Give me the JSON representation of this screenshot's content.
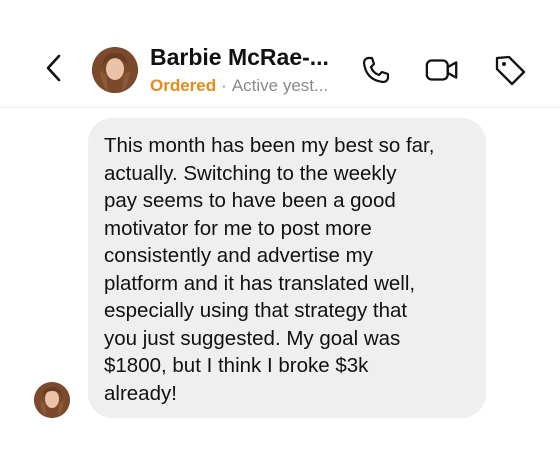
{
  "header": {
    "contact_name": "Barbie McRae-...",
    "status": "Ordered",
    "separator": "·",
    "activity": "Active yest..."
  },
  "icons": {
    "back": "chevron-left-icon",
    "call": "phone-icon",
    "video": "video-camera-icon",
    "tag": "tag-icon"
  },
  "colors": {
    "status_accent": "#e88a1a",
    "bubble_background": "#efefef"
  },
  "messages": [
    {
      "sender": "incoming",
      "text": "This month has been my best so far,\nactually. Switching to the weekly\npay seems to have been a good\nmotivator for me to post more\nconsistently and advertise my\nplatform and it has translated well,\nespecially using that strategy that\nyou just suggested. My goal was\n$1800, but I think I broke $3k\nalready!"
    }
  ]
}
